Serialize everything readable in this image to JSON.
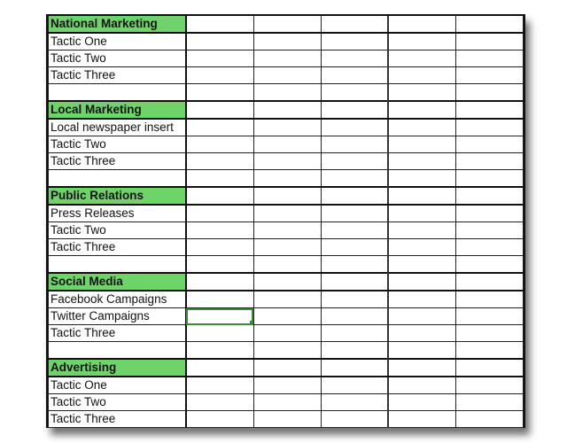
{
  "sheet": {
    "header_color": "#6ed46a",
    "selection_color": "#3b8a3b",
    "columns_extra": 5,
    "selected_cell": {
      "group": 3,
      "row": 1,
      "col": 0
    },
    "groups": [
      {
        "title": "National Marketing",
        "rows": [
          "Tactic One",
          "Tactic Two",
          "Tactic Three",
          ""
        ]
      },
      {
        "title": "Local Marketing",
        "rows": [
          "Local newspaper insert",
          "Tactic Two",
          "Tactic Three",
          ""
        ]
      },
      {
        "title": "Public Relations",
        "rows": [
          "Press Releases",
          "Tactic Two",
          "Tactic Three",
          ""
        ]
      },
      {
        "title": "Social Media",
        "rows": [
          "Facebook Campaigns",
          "Twitter Campaigns",
          "Tactic Three",
          ""
        ]
      },
      {
        "title": "Advertising",
        "rows": [
          "Tactic One",
          "Tactic Two",
          "Tactic Three"
        ]
      }
    ]
  }
}
